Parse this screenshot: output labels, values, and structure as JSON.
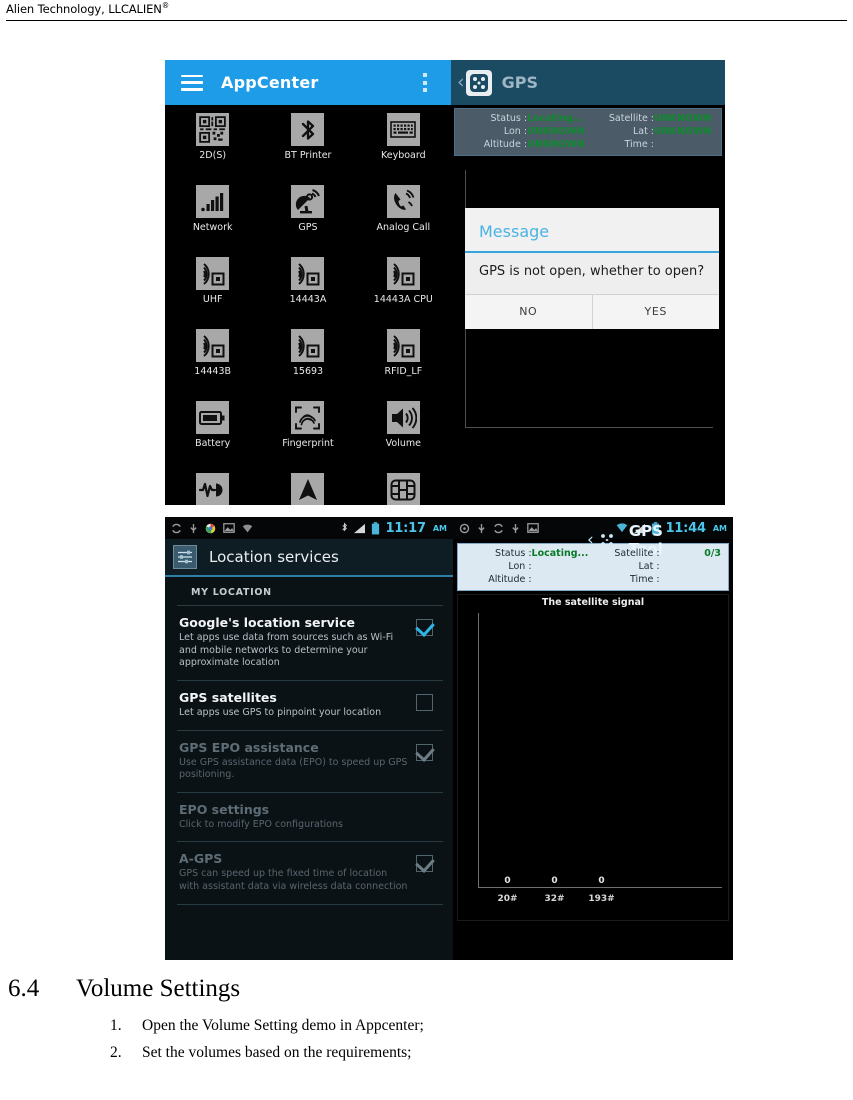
{
  "page_header": {
    "company": "Alien Technology, LLCALIEN",
    "trademark": "®"
  },
  "figure": {
    "appcenter": {
      "titlebar": {
        "title": "AppCenter",
        "menu_icon": "hamburger-menu-icon",
        "overflow_icon": "overflow-menu-icon",
        "bar_color": "#1e9ce8"
      },
      "apps": [
        {
          "label": "2D(S)",
          "icon": "qr-code-icon"
        },
        {
          "label": "BT Printer",
          "icon": "bluetooth-icon"
        },
        {
          "label": "Keyboard",
          "icon": "keyboard-icon"
        },
        {
          "label": "Network",
          "icon": "signal-bars-icon"
        },
        {
          "label": "GPS",
          "icon": "satellite-dish-icon"
        },
        {
          "label": "Analog Call",
          "icon": "phone-ringing-icon"
        },
        {
          "label": "UHF",
          "icon": "rfid-waves-icon"
        },
        {
          "label": "14443A",
          "icon": "rfid-waves-icon"
        },
        {
          "label": "14443A CPU",
          "icon": "rfid-waves-icon"
        },
        {
          "label": "14443B",
          "icon": "rfid-waves-icon"
        },
        {
          "label": "15693",
          "icon": "rfid-waves-icon"
        },
        {
          "label": "RFID_LF",
          "icon": "rfid-waves-icon"
        },
        {
          "label": "Battery",
          "icon": "battery-icon"
        },
        {
          "label": "Fingerprint",
          "icon": "fingerprint-icon"
        },
        {
          "label": "Volume",
          "icon": "speaker-volume-icon"
        },
        {
          "label": "",
          "icon": "audio-wave-icon"
        },
        {
          "label": "",
          "icon": "compass-needle-icon"
        },
        {
          "label": "",
          "icon": "sim-chip-icon"
        }
      ]
    },
    "gps_demo": {
      "titlebar": {
        "title": "GPS",
        "back_icon": "back-chevron-icon",
        "app_icon": "gps-app-icon"
      },
      "info": {
        "status_label": "Status :",
        "status_value": "Locating...",
        "satellite_label": "Satellite :",
        "satellite_value": "UNKNOWN",
        "lon_label": "Lon :",
        "lon_value": "UNKNOWN",
        "lat_label": "Lat :",
        "lat_value": "UNKNOWN",
        "altitude_label": "Altitude :",
        "altitude_value": "UNKNOWN",
        "time_label": "Time :",
        "time_value": ""
      },
      "dialog": {
        "title": "Message",
        "message": "GPS is not open, whether to open?",
        "no_label": "NO",
        "yes_label": "YES",
        "accent_color": "#36a6dd"
      }
    },
    "location_services": {
      "statusbar": {
        "time": "11:17",
        "ampm": "AM",
        "icons": [
          "sync-icon",
          "usb-icon",
          "chrome-icon",
          "screenshot-icon",
          "wifi-icon",
          "bluetooth-icon",
          "signal-bars-icon",
          "battery-icon"
        ]
      },
      "titlebar": {
        "title": "Location services",
        "app_icon": "settings-sliders-icon"
      },
      "section_header": "MY LOCATION",
      "items": [
        {
          "title": "Google's location service",
          "subtitle": "Let apps use data from sources such as Wi-Fi and mobile networks to determine your approximate location",
          "checkbox": "checked",
          "dim": false
        },
        {
          "title": "GPS satellites",
          "subtitle": "Let apps use GPS to pinpoint your location",
          "checkbox": "unchecked",
          "dim": false
        },
        {
          "title": "GPS EPO assistance",
          "subtitle": "Use GPS assistance data (EPO) to speed up GPS positioning.",
          "checkbox": "checked-dim",
          "dim": true
        },
        {
          "title": "EPO settings",
          "subtitle": "Click to modify EPO configurations",
          "checkbox": "none",
          "dim": true
        },
        {
          "title": "A-GPS",
          "subtitle": "GPS can speed up the fixed time of location with assistant data via wireless data connection",
          "checkbox": "checked-dim",
          "dim": true
        }
      ]
    },
    "gps_tool": {
      "statusbar": {
        "time": "11:44",
        "ampm": "AM",
        "icons": [
          "sync-icon",
          "usb-icon",
          "sync-icon",
          "usb-icon",
          "screenshot-icon",
          "wifi-icon",
          "signal-bars-icon",
          "battery-icon"
        ]
      },
      "titlebar": {
        "title": "GPS Tool",
        "back_icon": "back-chevron-icon",
        "app_icon": "gps-app-icon",
        "bar_color": "#2b93cf"
      },
      "info": {
        "status_label": "Status :",
        "status_value": "Locating...",
        "satellite_label": "Satellite :",
        "satellite_value": "0/3",
        "lon_label": "Lon :",
        "lon_value": "",
        "lat_label": "Lat :",
        "lat_value": "",
        "altitude_label": "Altitude :",
        "altitude_value": "",
        "time_label": "Time :",
        "time_value": ""
      }
    }
  },
  "chart_data": {
    "type": "bar",
    "title": "The satellite signal",
    "categories": [
      "20#",
      "32#",
      "193#"
    ],
    "values": [
      0,
      0,
      0
    ],
    "data_labels": [
      "0",
      "0",
      "0"
    ],
    "xlabel": "",
    "ylabel": "",
    "ylim": [
      0,
      50
    ],
    "grid": false,
    "legend": "none"
  },
  "document": {
    "section_number": "6.4",
    "section_title": "Volume Settings",
    "steps": [
      {
        "num": "1.",
        "text": "Open the Volume Setting demo in Appcenter;"
      },
      {
        "num": "2.",
        "text": "Set the volumes based on the requirements;"
      }
    ]
  }
}
